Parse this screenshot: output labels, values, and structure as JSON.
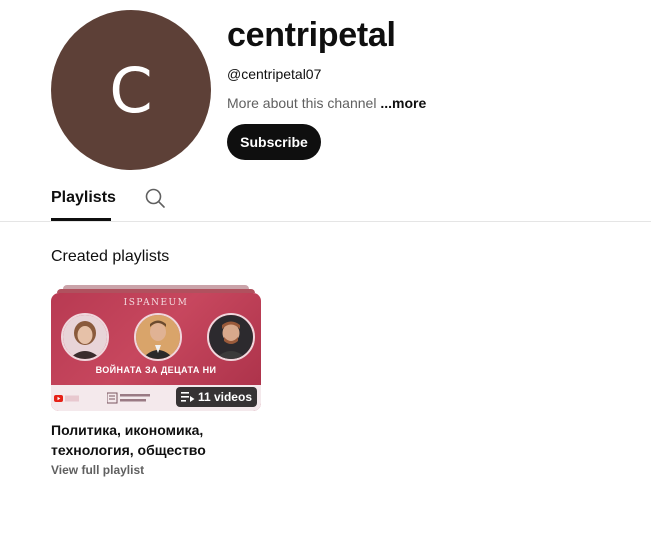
{
  "channel": {
    "avatar_letter": "C",
    "avatar_color": "#5d4037",
    "name": "centripetal",
    "handle": "@centripetal07",
    "about_text": "More about this channel",
    "more_label": "...more",
    "subscribe_label": "Subscribe"
  },
  "tabs": [
    {
      "label": "Playlists",
      "selected": true
    }
  ],
  "search_icon": "search-icon",
  "section": {
    "title": "Created playlists"
  },
  "playlist": {
    "thumbnail_brand": "ISPANEUM",
    "thumbnail_headline": "ВОЙНАТА ЗА ДЕЦАТА НИ",
    "video_count": "11 videos",
    "title": "Политика, икономика, технология, общество",
    "view_label": "View full playlist",
    "accent_color": "#b83a52"
  }
}
